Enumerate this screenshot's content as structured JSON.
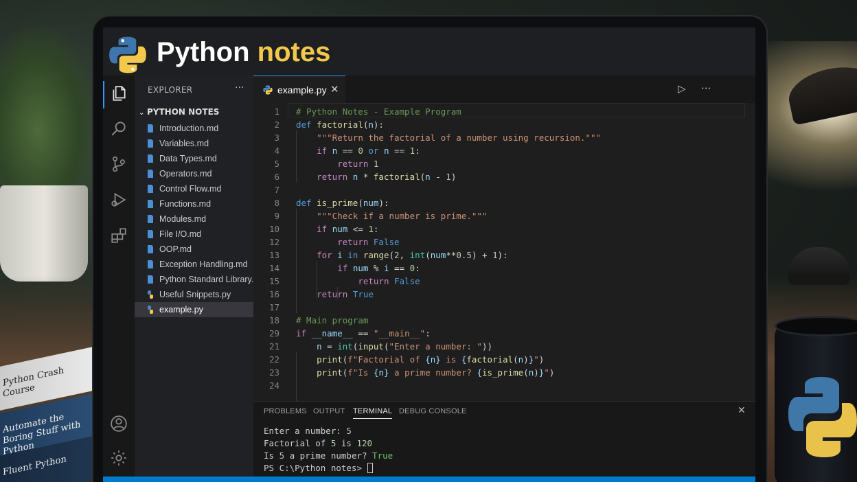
{
  "banner": {
    "title_main": "Python",
    "title_accent": "notes"
  },
  "explorer": {
    "header": "EXPLORER",
    "more": "···",
    "folder": "PYTHON NOTES",
    "files": [
      {
        "name": "Introduction.md",
        "icon": "markdown-file-icon"
      },
      {
        "name": "Variables.md",
        "icon": "markdown-file-icon"
      },
      {
        "name": "Data Types.md",
        "icon": "markdown-file-icon"
      },
      {
        "name": "Operators.md",
        "icon": "markdown-file-icon"
      },
      {
        "name": "Control Flow.md",
        "icon": "markdown-file-icon"
      },
      {
        "name": "Functions.md",
        "icon": "markdown-file-icon"
      },
      {
        "name": "Modules.md",
        "icon": "markdown-file-icon"
      },
      {
        "name": "File I/O.md",
        "icon": "markdown-file-icon"
      },
      {
        "name": "OOP.md",
        "icon": "markdown-file-icon"
      },
      {
        "name": "Exception Handling.md",
        "icon": "markdown-file-icon"
      },
      {
        "name": "Python Standard Library.md",
        "icon": "markdown-file-icon"
      },
      {
        "name": "Useful Snippets.py",
        "icon": "python-file-icon"
      },
      {
        "name": "example.py",
        "icon": "python-file-icon",
        "selected": true
      }
    ]
  },
  "editor": {
    "tab_label": "example.py",
    "close": "✕",
    "run": "▷",
    "more": "···",
    "line_numbers": [
      "1",
      "2",
      "3",
      "4",
      "5",
      "6",
      "7",
      "8",
      "9",
      "10",
      "12",
      "13",
      "14",
      "15",
      "16",
      "17",
      "18",
      "29",
      "21",
      "22",
      "23",
      "24"
    ]
  },
  "panel": {
    "tabs": [
      "PROBLEMS",
      "OUTPUT",
      "TERMINAL",
      "DEBUG CONSOLE"
    ],
    "active_tab": "TERMINAL",
    "close": "✕",
    "terminal": {
      "l1_text": "Enter a number: ",
      "l1_num": "5",
      "l2_a": "Factorial of ",
      "l2_n": "5",
      "l2_b": " is ",
      "l2_r": "120",
      "l3_a": "Is ",
      "l3_n": "5",
      "l3_b": " a prime number? ",
      "l3_r": "True",
      "prompt": "PS C:\\Python notes> "
    }
  },
  "books": {
    "b1": "Python Crash Course",
    "b2": "Automate the Boring Stuff with Python",
    "b3": "Fluent Python"
  },
  "colors": {
    "accent": "#f2c94c",
    "blue": "#3794ff",
    "status": "#007acc"
  }
}
